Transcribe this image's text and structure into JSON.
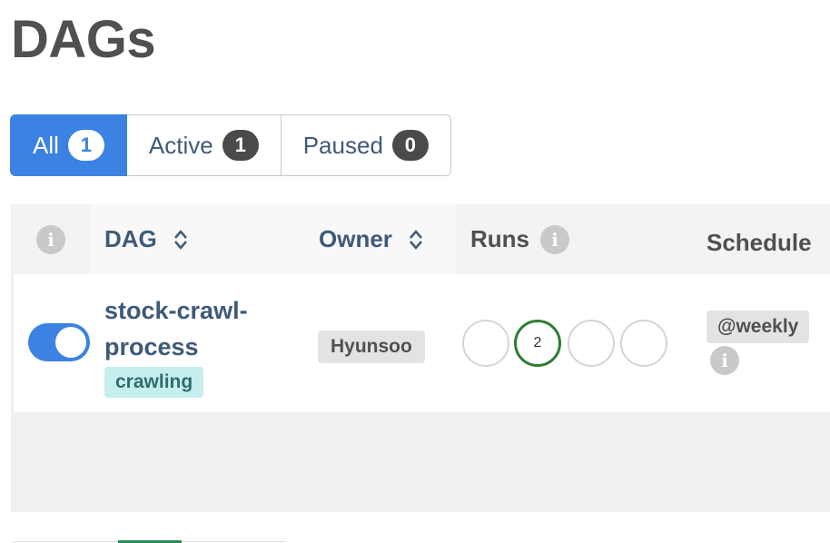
{
  "page": {
    "title": "DAGs"
  },
  "filters": [
    {
      "label": "All",
      "count": "1",
      "active": true
    },
    {
      "label": "Active",
      "count": "1",
      "active": false
    },
    {
      "label": "Paused",
      "count": "0",
      "active": false
    }
  ],
  "table": {
    "columns": {
      "info": "i",
      "dag": "DAG",
      "owner": "Owner",
      "runs": "Runs",
      "schedule": "Schedule"
    },
    "rows": [
      {
        "paused": false,
        "dag_id_line1": "stock-crawl-",
        "dag_id_line2": "process",
        "tag": "crawling",
        "owner": "Hyunsoo",
        "runs": [
          "",
          "2",
          "",
          ""
        ],
        "schedule": "@weekly",
        "schedule_info": "i"
      }
    ]
  },
  "colors": {
    "primary": "#3b82e3",
    "link": "#3e5a78",
    "success_run": "#2e7d32",
    "tag_bg": "#c6eeee"
  },
  "icons": {
    "info": "info-icon",
    "sort": "sort-icon"
  }
}
